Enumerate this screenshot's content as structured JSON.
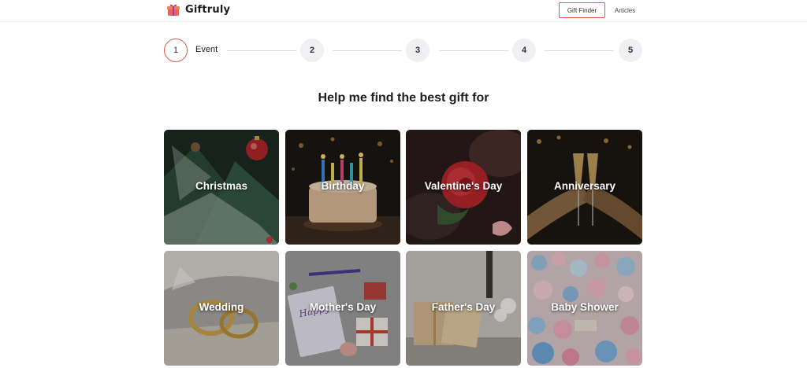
{
  "header": {
    "brand": "Giftruly",
    "gift_finder": "Gift Finder",
    "articles": "Articles"
  },
  "stepper": {
    "steps": [
      {
        "number": "1",
        "label": "Event",
        "active": true
      },
      {
        "number": "2",
        "label": "",
        "active": false
      },
      {
        "number": "3",
        "label": "",
        "active": false
      },
      {
        "number": "4",
        "label": "",
        "active": false
      },
      {
        "number": "5",
        "label": "",
        "active": false
      }
    ]
  },
  "heading": "Help me find the best gift for",
  "occasions": [
    {
      "label": "Christmas",
      "icon": "christmas-tree-photo"
    },
    {
      "label": "Birthday",
      "icon": "birthday-cake-photo"
    },
    {
      "label": "Valentine's Day",
      "icon": "red-rose-photo"
    },
    {
      "label": "Anniversary",
      "icon": "champagne-toast-photo"
    },
    {
      "label": "Wedding",
      "icon": "wedding-rings-photo"
    },
    {
      "label": "Mother's Day",
      "icon": "mothers-day-card-photo"
    },
    {
      "label": "Father's Day",
      "icon": "gift-boxes-photo"
    },
    {
      "label": "Baby Shower",
      "icon": "balloons-photo"
    }
  ],
  "colors": {
    "accent": "#e2574c",
    "step_bg": "#f0f0f2"
  }
}
